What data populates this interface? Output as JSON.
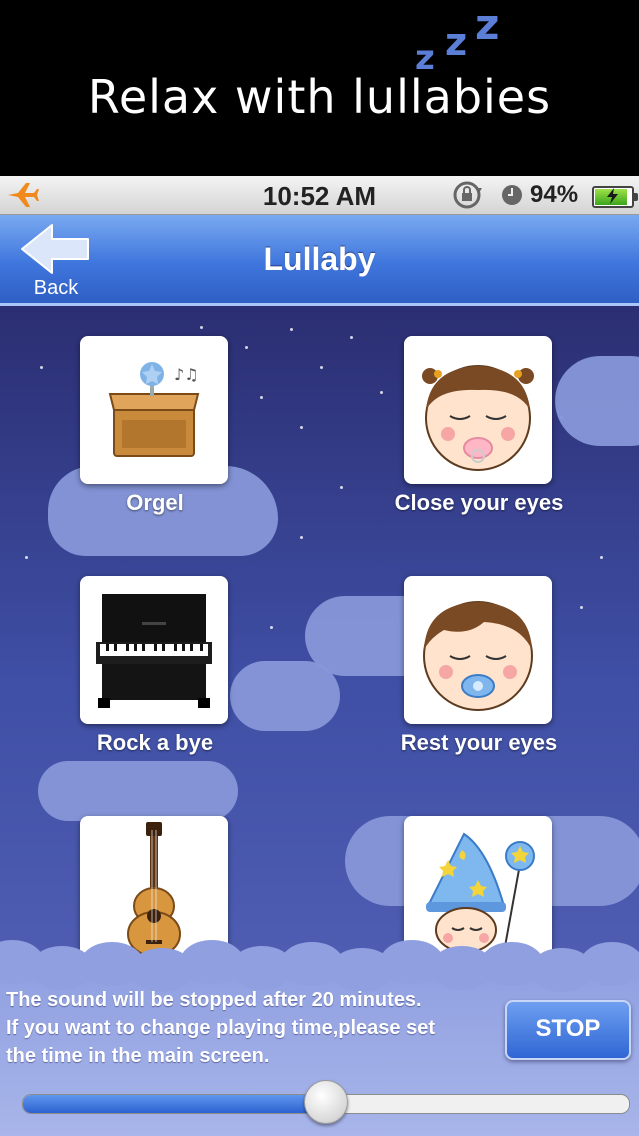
{
  "banner": {
    "title": "Relax with lullabies",
    "zzz": [
      "z",
      "z",
      "z"
    ]
  },
  "status_bar": {
    "time": "10:52 AM",
    "battery_percent": "94%",
    "battery_level": 0.94
  },
  "nav": {
    "title": "Lullaby",
    "back_label": "Back"
  },
  "songs": [
    {
      "label": "Orgel",
      "icon": "music-box-icon"
    },
    {
      "label": "Close your eyes",
      "icon": "baby-girl-pacifier-icon"
    },
    {
      "label": "Rock a bye",
      "icon": "piano-icon"
    },
    {
      "label": "Rest your eyes",
      "icon": "baby-boy-pacifier-icon"
    },
    {
      "label": "",
      "icon": "guitar-icon"
    },
    {
      "label": "",
      "icon": "wizard-baby-icon"
    }
  ],
  "timer": {
    "notice_lines": [
      "The sound will be stopped after 20 minutes.",
      "If you want to change playing time,please set",
      "the time in the main screen."
    ],
    "stop_label": "STOP",
    "slider_fraction": 0.5
  },
  "colors": {
    "nav_blue": "#3f76dd",
    "night_sky": "#2b2e72",
    "cloud": "#8797d8"
  }
}
